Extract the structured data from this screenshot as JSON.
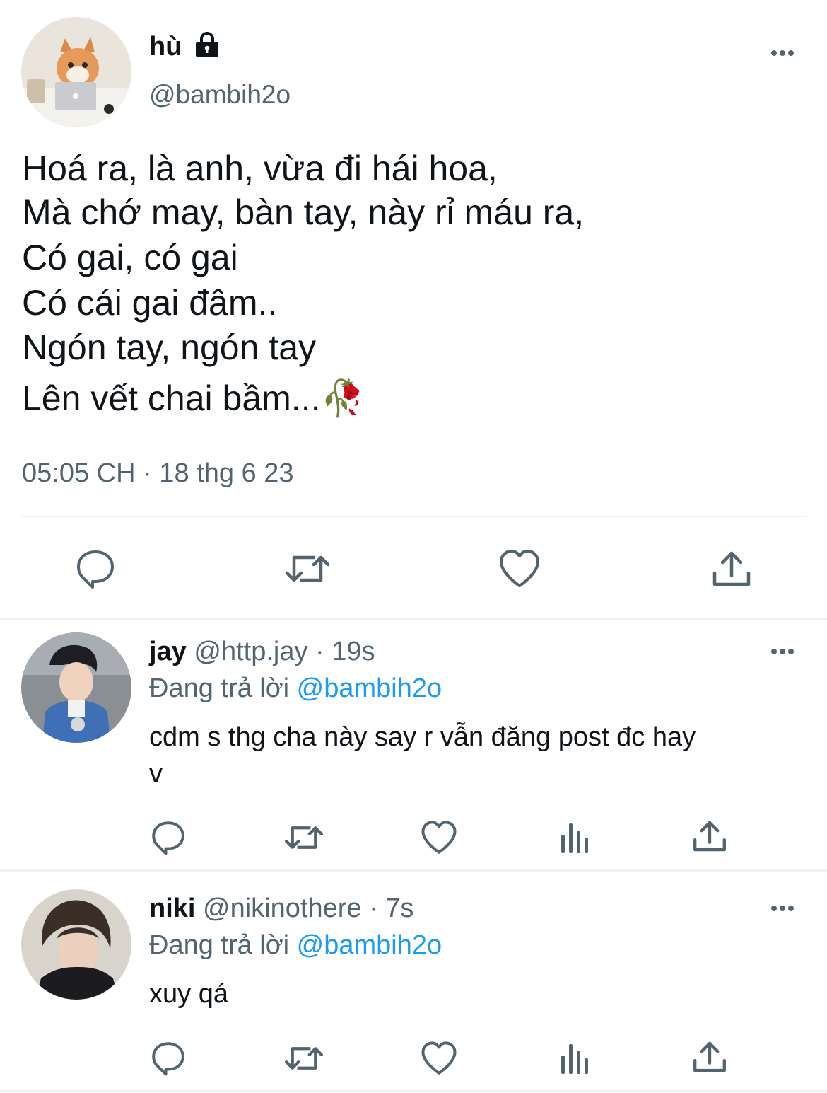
{
  "main_tweet": {
    "display_name": "hù",
    "handle": "@bambih2o",
    "lines": [
      "Hoá ra, là anh, vừa đi hái hoa,",
      "Mà chớ may, bàn tay, này rỉ máu ra,",
      "Có gai, có gai",
      "Có cái gai đâm..",
      "Ngón tay, ngón tay",
      "Lên vết chai bầm...🥀"
    ],
    "timestamp": "05:05 CH · 18 thg 6 23"
  },
  "replies": [
    {
      "display_name": "jay",
      "handle": "@http.jay",
      "time": "· 19s",
      "replying_prefix": "Đang trả lời",
      "replying_to": "@bambih2o",
      "text_line1": "cdm s thg cha này say r vẫn đăng post đc hay",
      "text_line2": "v"
    },
    {
      "display_name": "niki",
      "handle": "@nikinothere",
      "time": "· 7s",
      "replying_prefix": "Đang trả lời",
      "replying_to": "@bambih2o",
      "text_line1": "xuy qá"
    }
  ],
  "colors": {
    "text": "#0f1419",
    "muted": "#536471",
    "link": "#1d9bf0",
    "divider": "#eff3f4"
  }
}
